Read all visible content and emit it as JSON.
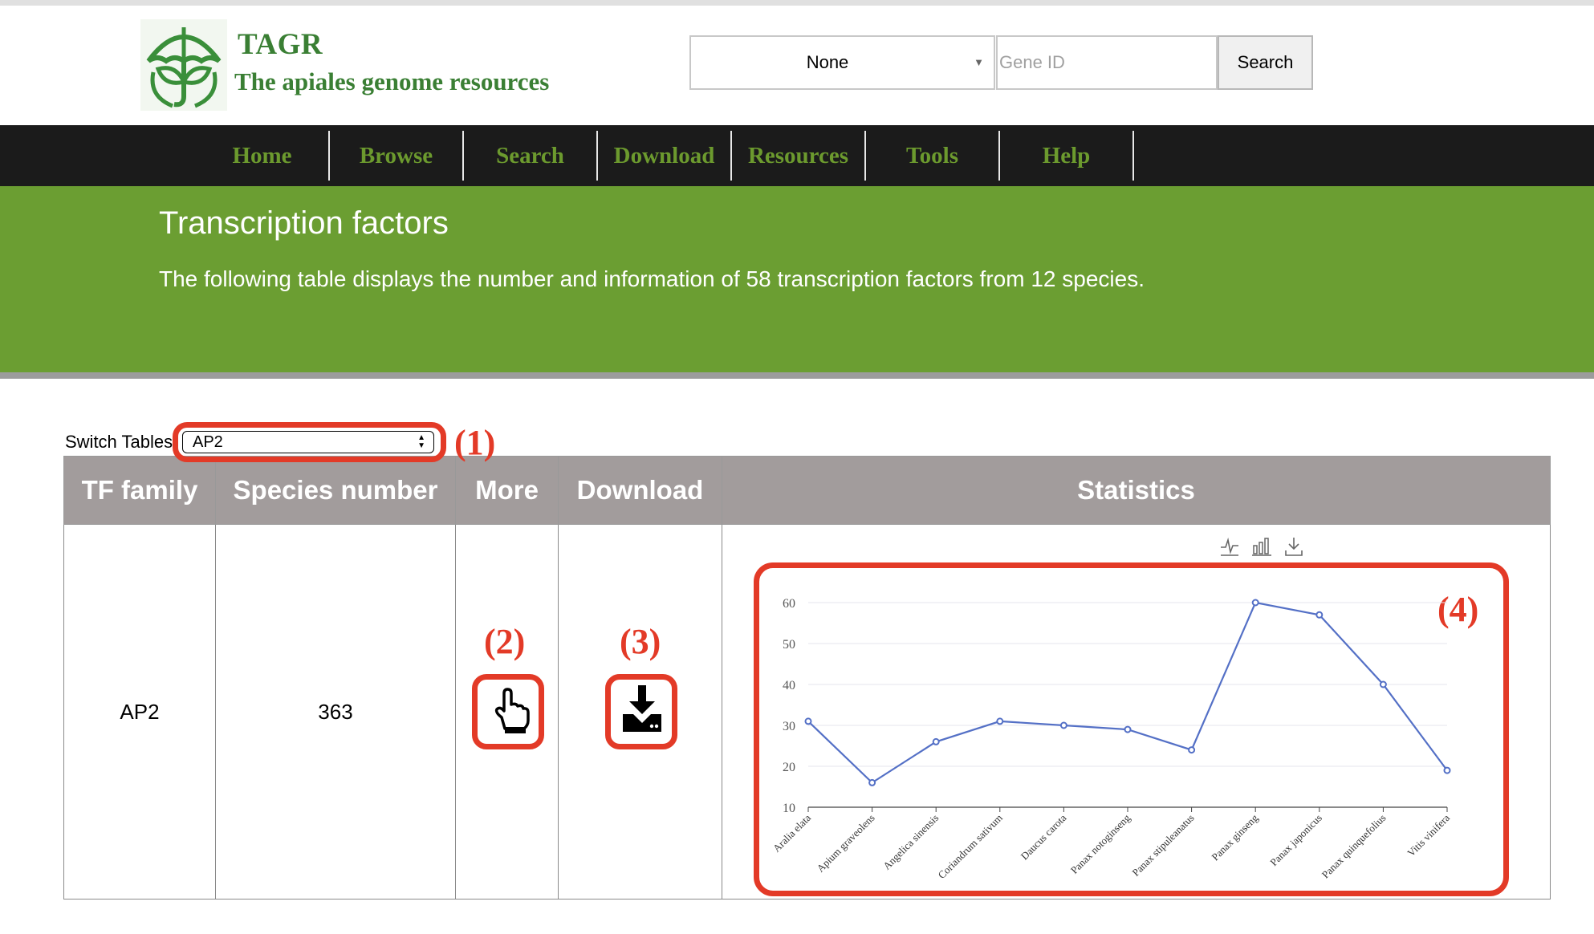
{
  "brand": {
    "title": "TAGR",
    "subtitle": "The apiales genome resources"
  },
  "search": {
    "species_value": "None",
    "gene_placeholder": "Gene ID",
    "button_label": "Search"
  },
  "nav": {
    "items": [
      {
        "label": "Home"
      },
      {
        "label": "Browse"
      },
      {
        "label": "Search"
      },
      {
        "label": "Download"
      },
      {
        "label": "Resources"
      },
      {
        "label": "Tools"
      },
      {
        "label": "Help"
      }
    ]
  },
  "banner": {
    "title": "Transcription factors",
    "description": "The following table displays the number and information of 58 transcription factors from 12 species."
  },
  "switch": {
    "label": "Switch Tables",
    "value": "AP2"
  },
  "annotations": [
    "(1)",
    "(2)",
    "(3)",
    "(4)"
  ],
  "table": {
    "headers": [
      "TF family",
      "Species number",
      "More",
      "Download",
      "Statistics"
    ],
    "row": {
      "family": "AP2",
      "species_number": "363"
    }
  },
  "colors": {
    "brand_green": "#3a7f34",
    "nav_text": "#6c9a2e",
    "banner": "#6b9e32",
    "header_gray": "#a29c9c",
    "annotation_red": "#e33a27",
    "series_blue": "#5470c6"
  },
  "icons": {
    "more": "pointer-hand-icon",
    "download": "download-drive-icon",
    "toolbox": [
      "line-chart-icon",
      "bar-chart-icon",
      "save-image-icon"
    ]
  },
  "chart_data": {
    "type": "line",
    "categories": [
      "Aralia elata",
      "Apium graveolens",
      "Angelica sinensis",
      "Coriandrum sativum",
      "Daucus carota",
      "Panax notoginseng",
      "Panax stipuleanatus",
      "Panax ginseng",
      "Panax japonicus",
      "Panax quinquefolius",
      "Vitis vinifera"
    ],
    "values": [
      31,
      16,
      26,
      31,
      30,
      29,
      24,
      60,
      57,
      40,
      19
    ],
    "yticks": [
      10,
      20,
      30,
      40,
      50,
      60
    ],
    "ylim": [
      10,
      60
    ],
    "grid": true
  }
}
